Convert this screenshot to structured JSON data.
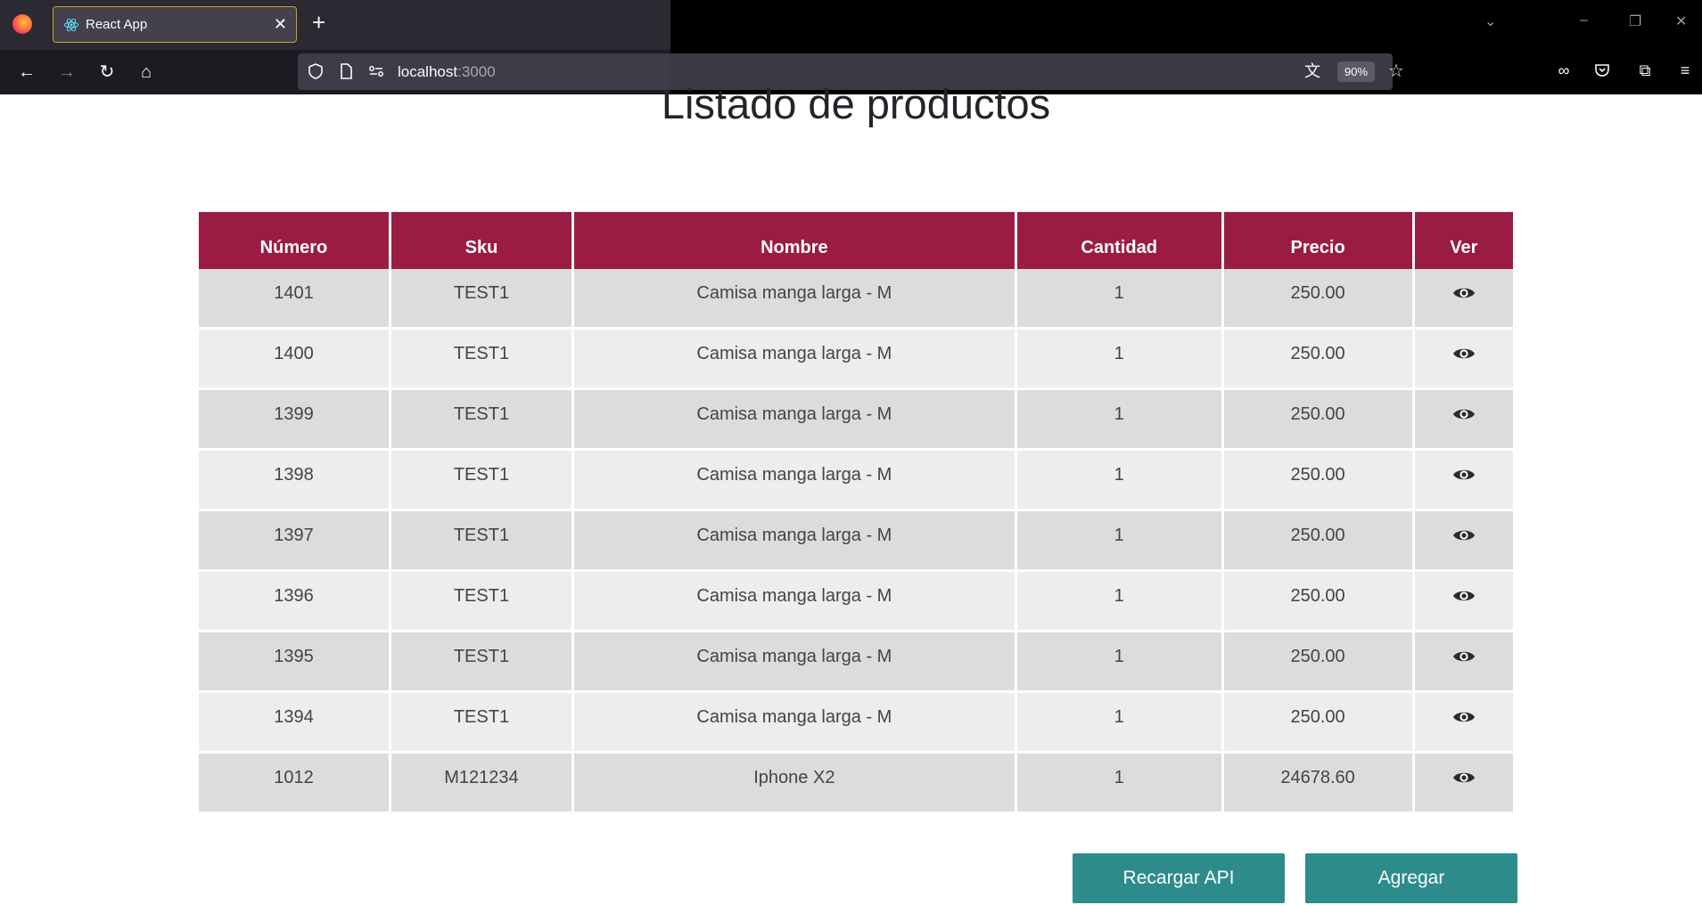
{
  "browser": {
    "tab_title": "React App",
    "url_host": "localhost",
    "url_port": ":3000",
    "zoom": "90%"
  },
  "page": {
    "title": "Listado de productos",
    "table": {
      "headers": [
        "Número",
        "Sku",
        "Nombre",
        "Cantidad",
        "Precio",
        "Ver"
      ],
      "rows": [
        {
          "numero": "1401",
          "sku": "TEST1",
          "nombre": "Camisa manga larga - M",
          "cantidad": "1",
          "precio": "250.00"
        },
        {
          "numero": "1400",
          "sku": "TEST1",
          "nombre": "Camisa manga larga - M",
          "cantidad": "1",
          "precio": "250.00"
        },
        {
          "numero": "1399",
          "sku": "TEST1",
          "nombre": "Camisa manga larga - M",
          "cantidad": "1",
          "precio": "250.00"
        },
        {
          "numero": "1398",
          "sku": "TEST1",
          "nombre": "Camisa manga larga - M",
          "cantidad": "1",
          "precio": "250.00"
        },
        {
          "numero": "1397",
          "sku": "TEST1",
          "nombre": "Camisa manga larga - M",
          "cantidad": "1",
          "precio": "250.00"
        },
        {
          "numero": "1396",
          "sku": "TEST1",
          "nombre": "Camisa manga larga - M",
          "cantidad": "1",
          "precio": "250.00"
        },
        {
          "numero": "1395",
          "sku": "TEST1",
          "nombre": "Camisa manga larga - M",
          "cantidad": "1",
          "precio": "250.00"
        },
        {
          "numero": "1394",
          "sku": "TEST1",
          "nombre": "Camisa manga larga - M",
          "cantidad": "1",
          "precio": "250.00"
        },
        {
          "numero": "1012",
          "sku": "M121234",
          "nombre": "Iphone X2",
          "cantidad": "1",
          "precio": "24678.60"
        }
      ]
    },
    "buttons": {
      "reload_label": "Recargar API",
      "add_label": "Agregar"
    }
  },
  "colors": {
    "header_bg": "#9b1c43",
    "button_bg": "#2e8b8b"
  },
  "icons": {
    "view": "eye-icon"
  }
}
